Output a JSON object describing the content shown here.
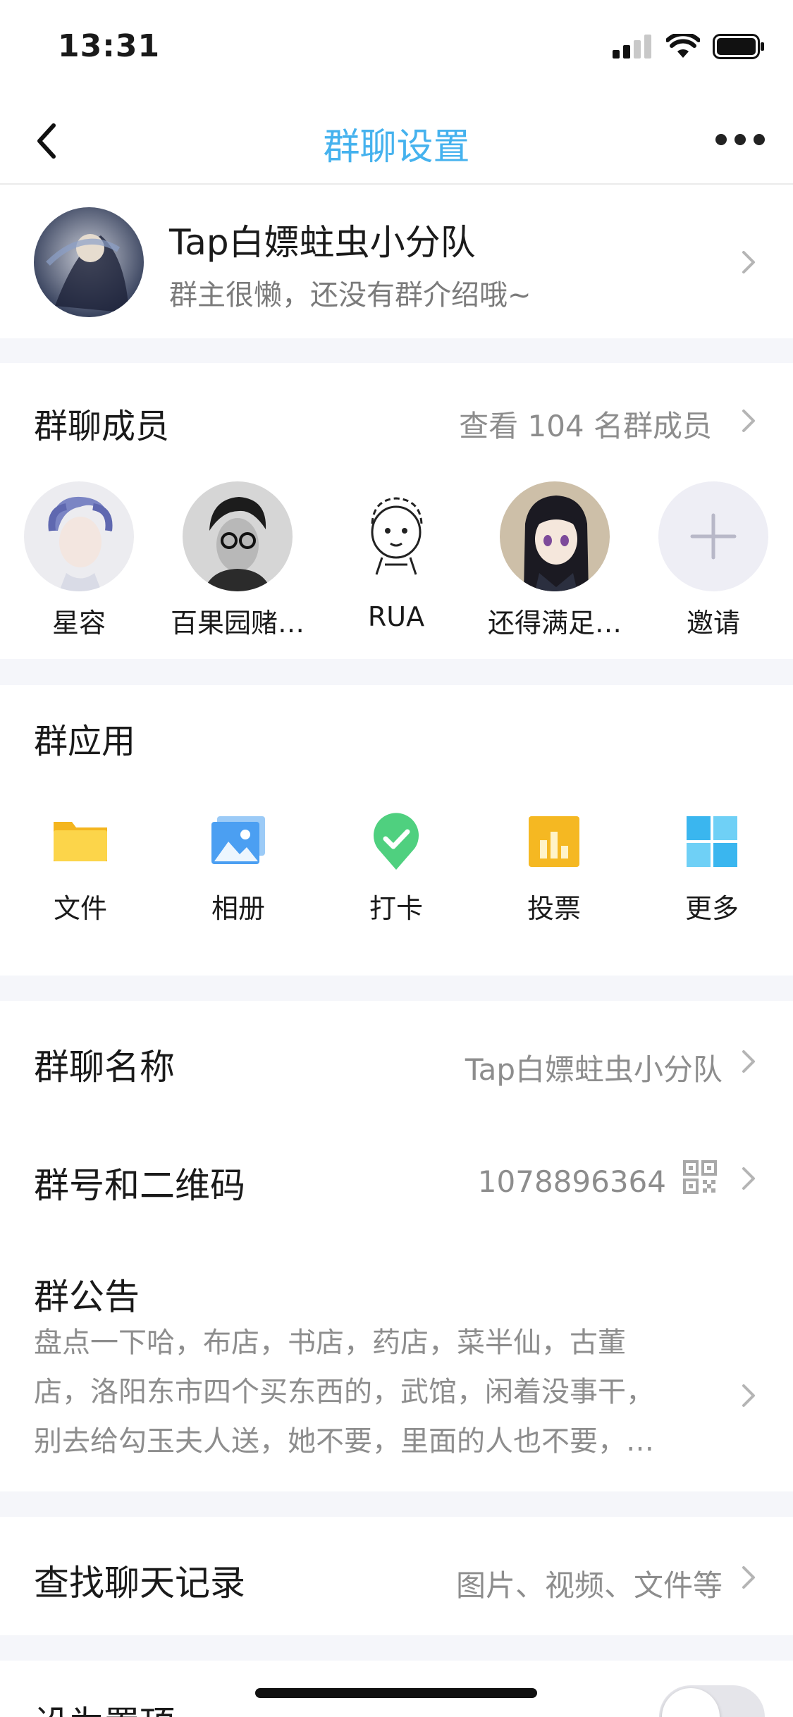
{
  "status_bar": {
    "time": "13:31"
  },
  "nav": {
    "title": "群聊设置"
  },
  "group": {
    "name": "Tap白嫖蛀虫小分队",
    "intro": "群主很懒，还没有群介绍哦~"
  },
  "members": {
    "title": "群聊成员",
    "view_all": "查看 104 名群成员",
    "list": [
      {
        "name": "星容"
      },
      {
        "name": "百果园赌…"
      },
      {
        "name": "RUA"
      },
      {
        "name": "还得满足…"
      }
    ],
    "invite_label": "邀请"
  },
  "apps": {
    "title": "群应用",
    "items": [
      {
        "label": "文件",
        "icon": "folder-icon",
        "color": "#f7c533"
      },
      {
        "label": "相册",
        "icon": "photo-icon",
        "color": "#4a9ff5"
      },
      {
        "label": "打卡",
        "icon": "checkin-icon",
        "color": "#4fd07f"
      },
      {
        "label": "投票",
        "icon": "vote-icon",
        "color": "#f7bb2a"
      },
      {
        "label": "更多",
        "icon": "grid-icon",
        "color": "#3ab6ef"
      }
    ]
  },
  "settings": {
    "name_label": "群聊名称",
    "name_value": "Tap白嫖蛀虫小分队",
    "id_label": "群号和二维码",
    "id_value": "1078896364",
    "notice_label": "群公告",
    "notice_lines": [
      "盘点一下哈，布店，书店，药店，菜半仙，古董",
      "店，洛阳东市四个买东西的，武馆，闲着没事干，",
      "别去给勾玉夫人送，她不要，里面的人也不要，…"
    ]
  },
  "search": {
    "label": "查找聊天记录",
    "hint": "图片、视频、文件等"
  },
  "pin": {
    "label": "设为置顶",
    "enabled": false
  }
}
